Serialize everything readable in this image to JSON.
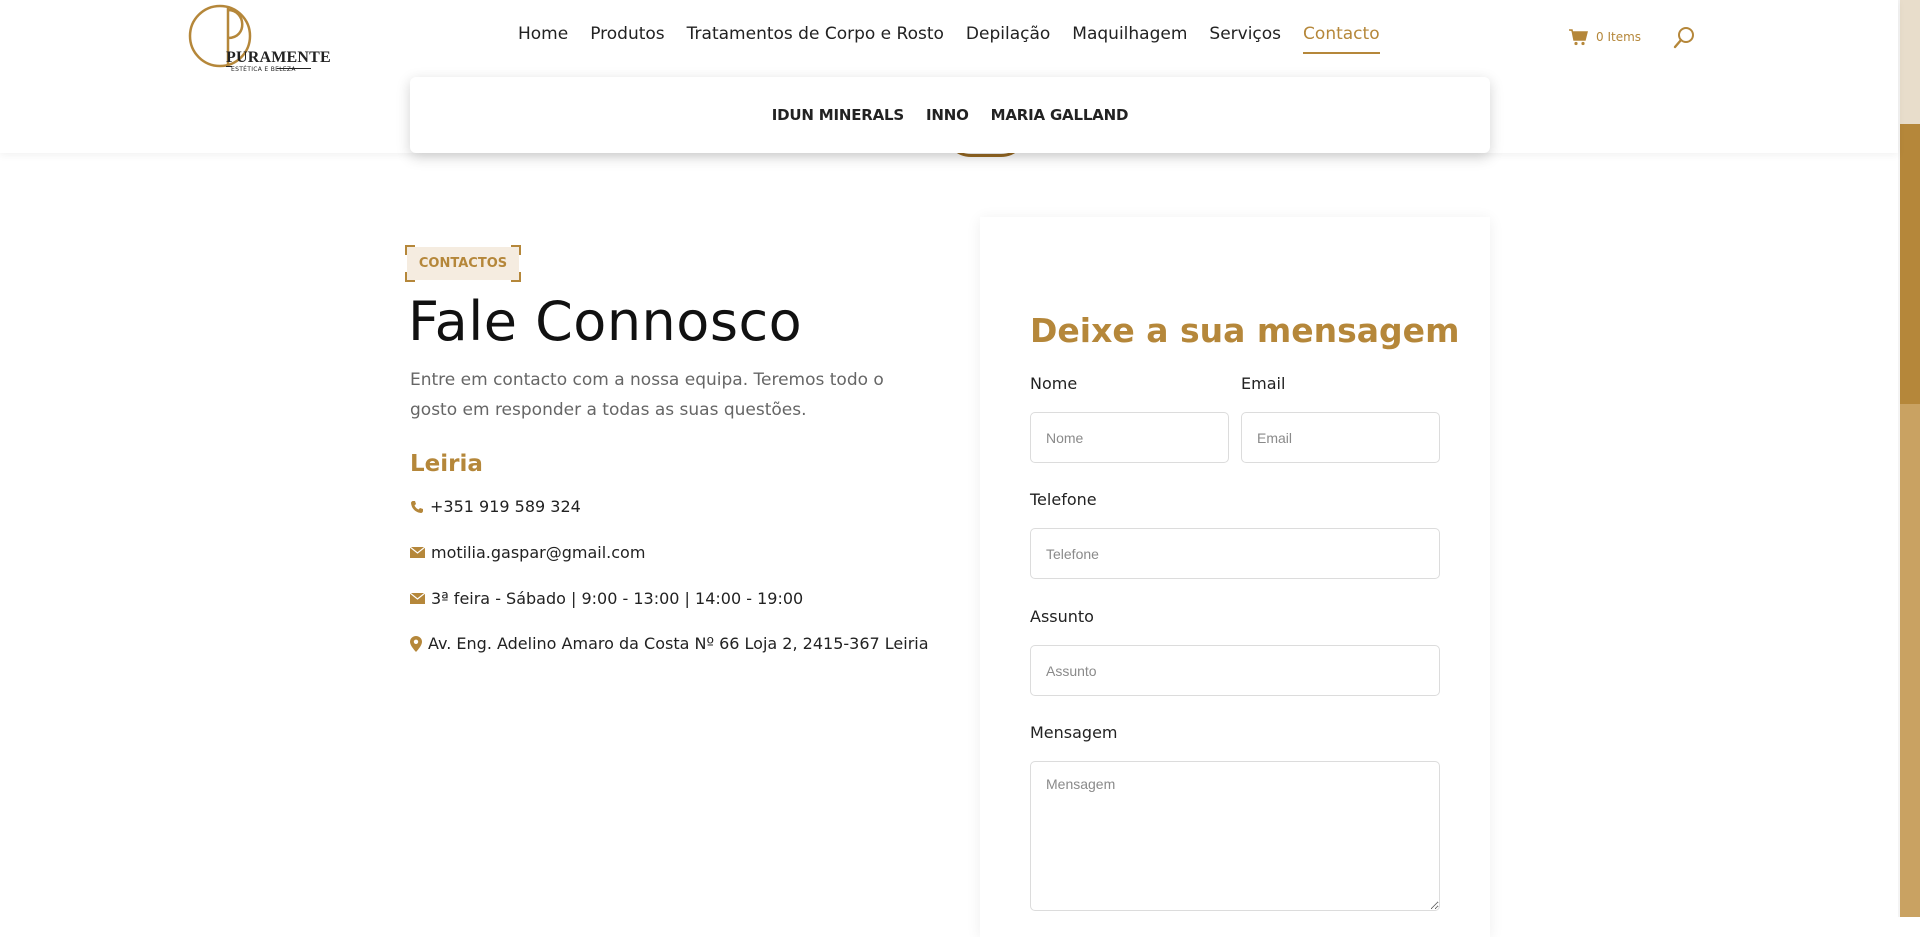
{
  "brand": {
    "name": "PURAMENTE",
    "tagline": "ESTÉTICA E BELEZA"
  },
  "nav": {
    "items": [
      {
        "label": "Home",
        "active": false
      },
      {
        "label": "Produtos",
        "active": false
      },
      {
        "label": "Tratamentos de Corpo e Rosto",
        "active": false
      },
      {
        "label": "Depilação",
        "active": false
      },
      {
        "label": "Maquilhagem",
        "active": false
      },
      {
        "label": "Serviços",
        "active": false
      },
      {
        "label": "Contacto",
        "active": true
      }
    ],
    "cart_label": "0 Items",
    "cart_icon": "cart-icon",
    "search_icon": "search-icon"
  },
  "submenu": {
    "items": [
      "IDUN MINERALS",
      "INNO",
      "MARIA GALLAND"
    ]
  },
  "contact": {
    "tag": "CONTACTOS",
    "title": "Fale Connosco",
    "intro": "Entre em contacto com a nossa equipa. Teremos todo o gosto em responder a todas as suas questões.",
    "city": "Leiria",
    "phone": "+351 919 589 324",
    "email": "motilia.gaspar@gmail.com",
    "hours": "3ª feira - Sábado | 9:00 - 13:00 | 14:00 - 19:00",
    "address": "Av. Eng. Adelino Amaro da Costa Nº 66 Loja 2, 2415-367 Leiria"
  },
  "form": {
    "title": "Deixe a sua mensagem",
    "name_label": "Nome",
    "name_placeholder": "Nome",
    "email_label": "Email",
    "email_placeholder": "Email",
    "phone_label": "Telefone",
    "phone_placeholder": "Telefone",
    "subject_label": "Assunto",
    "subject_placeholder": "Assunto",
    "message_label": "Mensagem",
    "message_placeholder": "Mensagem"
  },
  "colors": {
    "accent": "#b5873a",
    "text": "#222222",
    "muted": "#666666",
    "tag_bg": "#f5ece0"
  }
}
